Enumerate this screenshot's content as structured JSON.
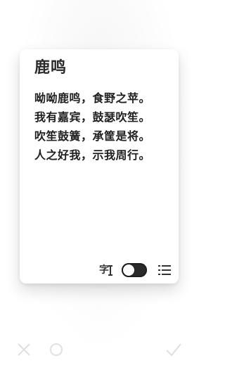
{
  "card": {
    "title": "鹿鸣",
    "lines": [
      "呦呦鹿鸣，食野之苹。",
      "我有嘉宾，鼓瑟吹笙。",
      "吹笙鼓簧，承筐是将。",
      "人之好我，示我周行。"
    ],
    "controls": {
      "font_size_char": "字",
      "font_size_icon": "text-cursor-icon",
      "toggle_state": "on",
      "list_icon": "list-icon"
    }
  },
  "bottom_bar": {
    "left_icon": "close-icon",
    "middle_icon": "circle-icon",
    "right_icon": "check-icon"
  },
  "colors": {
    "background": "#ffffff",
    "card": "#ffffff",
    "text": "#1f1f1f",
    "toggle_on": "#2a2a2a"
  }
}
